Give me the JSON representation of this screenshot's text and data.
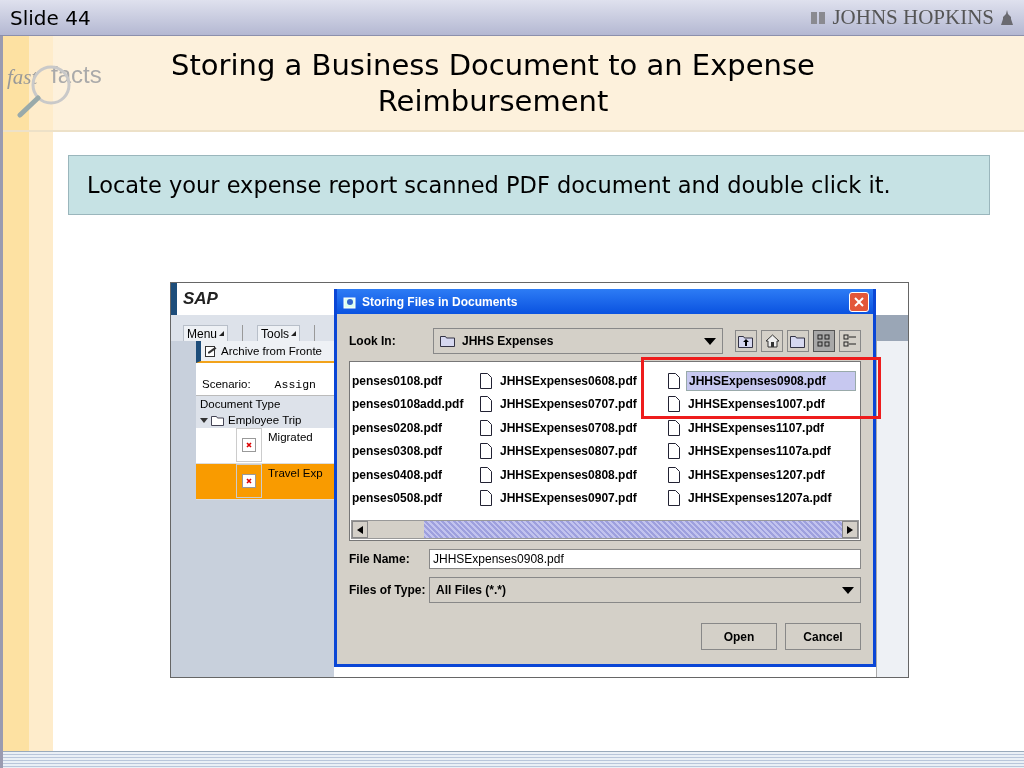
{
  "slide": {
    "label": "Slide 44",
    "brand": "JOHNS HOPKINS",
    "logo": {
      "first": "fast",
      "second": "facts"
    }
  },
  "title": "Storing a Business Document to an Expense Reimbursement",
  "instruction": "Locate your expense report scanned PDF document and double click it.",
  "sap": {
    "logo": "SAP",
    "menus": [
      "Menu",
      "Tools"
    ],
    "archive_button": "Archive from Fronte",
    "scenario_label": "Scenario:",
    "scenario_value": "Assign",
    "tree_header": "Document Type",
    "tree": [
      {
        "label": "Employee Trip",
        "expanded": true,
        "children": [
          {
            "label": "Migrated",
            "selected": false
          },
          {
            "label": "Travel Exp",
            "selected": true
          }
        ]
      }
    ]
  },
  "dialog": {
    "title": "Storing Files in Documents",
    "look_in_label": "Look In:",
    "look_in_value": "JHHS Expenses",
    "views": [
      {
        "kind": "list",
        "selected": true
      },
      {
        "kind": "details",
        "selected": false
      }
    ],
    "file_columns": [
      {
        "icons_shown": false,
        "files": [
          {
            "name": "penses0108.pdf",
            "selected": false
          },
          {
            "name": "penses0108add.pdf",
            "selected": false
          },
          {
            "name": "penses0208.pdf",
            "selected": false
          },
          {
            "name": "penses0308.pdf",
            "selected": false
          },
          {
            "name": "penses0408.pdf",
            "selected": false
          },
          {
            "name": "penses0508.pdf",
            "selected": false
          }
        ]
      },
      {
        "icons_shown": true,
        "files": [
          {
            "name": "JHHSExpenses0608.pdf",
            "selected": false
          },
          {
            "name": "JHHSExpenses0707.pdf",
            "selected": false
          },
          {
            "name": "JHHSExpenses0708.pdf",
            "selected": false
          },
          {
            "name": "JHHSExpenses0807.pdf",
            "selected": false
          },
          {
            "name": "JHHSExpenses0808.pdf",
            "selected": false
          },
          {
            "name": "JHHSExpenses0907.pdf",
            "selected": false
          }
        ]
      },
      {
        "icons_shown": true,
        "files": [
          {
            "name": "JHHSExpenses0908.pdf",
            "selected": true
          },
          {
            "name": "JHHSExpenses1007.pdf",
            "selected": false
          },
          {
            "name": "JHHSExpenses1107.pdf",
            "selected": false
          },
          {
            "name": "JHHSExpenses1107a.pdf",
            "selected": false
          },
          {
            "name": "JHHSExpenses1207.pdf",
            "selected": false
          },
          {
            "name": "JHHSExpenses1207a.pdf",
            "selected": false
          }
        ]
      }
    ],
    "file_name_label": "File Name:",
    "file_name_value": "JHHSExpenses0908.pdf",
    "type_label": "Files of Type:",
    "type_value": "All Files (*.*)",
    "buttons": [
      "Open",
      "Cancel"
    ]
  }
}
